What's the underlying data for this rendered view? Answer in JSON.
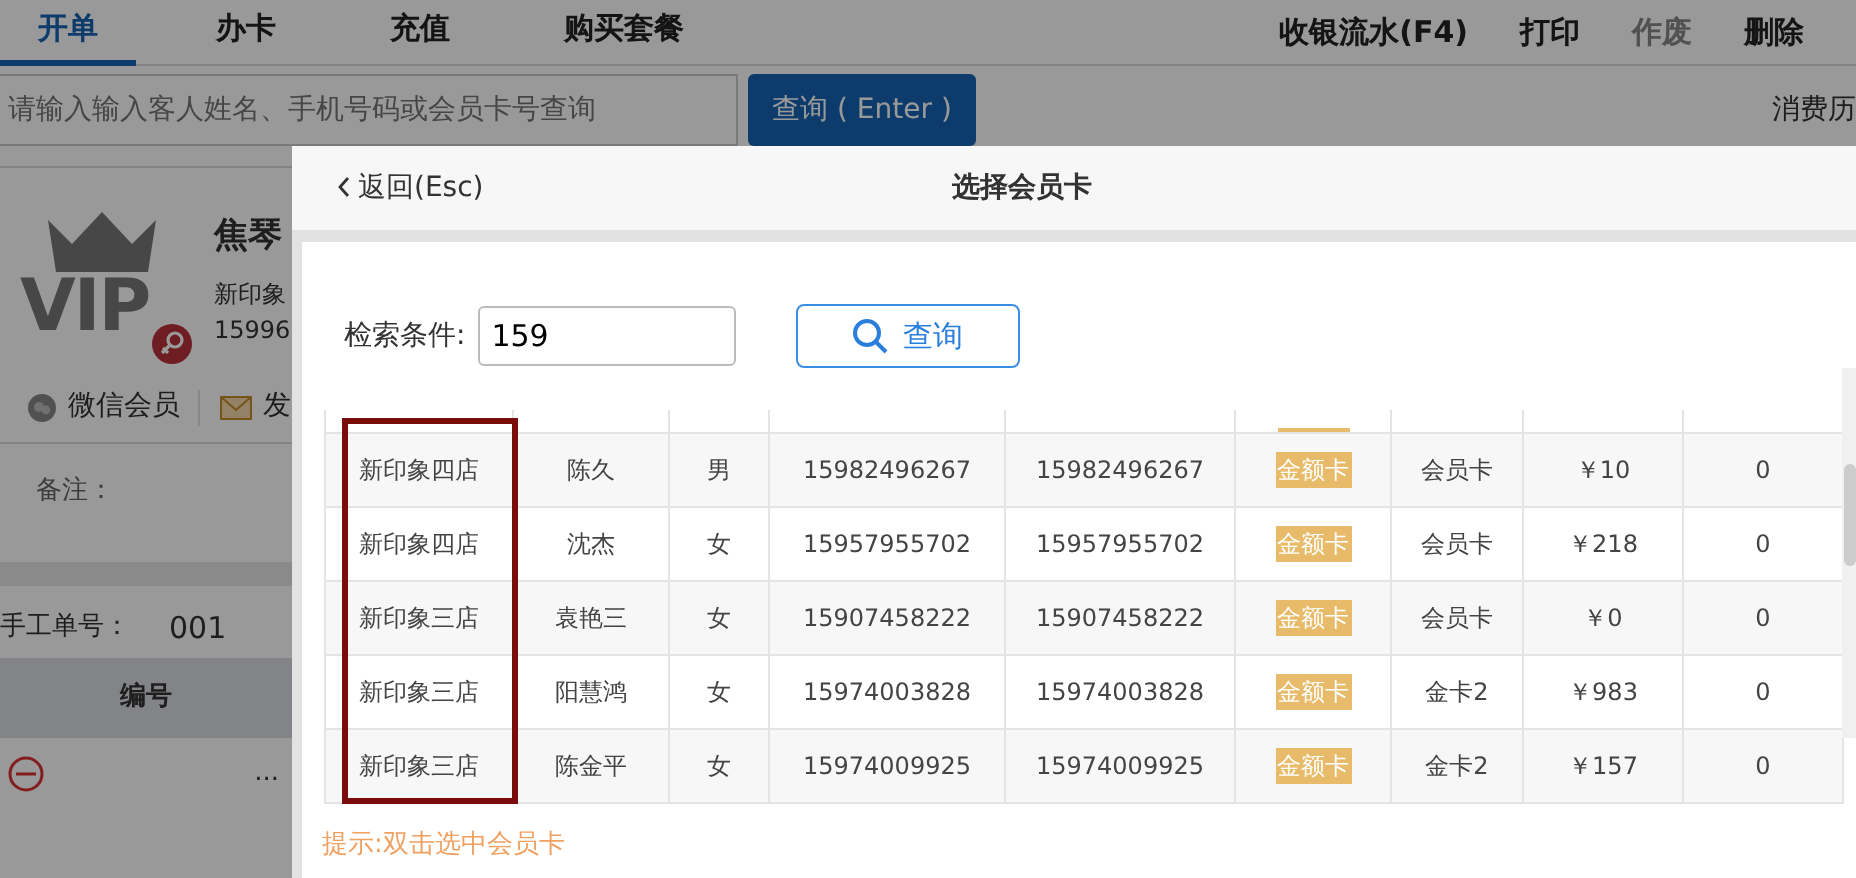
{
  "tabs": [
    {
      "label": "开单",
      "selected": true
    },
    {
      "label": "办卡",
      "selected": false
    },
    {
      "label": "充值",
      "selected": false
    },
    {
      "label": "购买套餐",
      "selected": false
    }
  ],
  "actions": [
    {
      "label": "收银流水(F4)",
      "disabled": false
    },
    {
      "label": "打印",
      "disabled": false
    },
    {
      "label": "作废",
      "disabled": true
    },
    {
      "label": "删除",
      "disabled": false
    }
  ],
  "search": {
    "placeholder": "请输入输入客人姓名、手机号码或会员卡号查询",
    "button": "查询 ( Enter )"
  },
  "history_link": "消费历",
  "member": {
    "logo": "VIP",
    "name": "焦琴",
    "store": "新印象",
    "phone": "15996",
    "wechat": "微信会员",
    "send": "发"
  },
  "remark_label": "备注：",
  "manual_no": {
    "label": "手工单号：",
    "value": "001"
  },
  "order_table": {
    "columns": [
      "编号"
    ],
    "rows": [
      {
        "cell": "..."
      }
    ]
  },
  "dialog": {
    "back": "返回(Esc)",
    "title": "选择会员卡",
    "search_label": "检索条件:",
    "search_value": "159",
    "search_button": "查询",
    "store_column_outlined": true,
    "rows": [
      {
        "store": "新印象四店",
        "name": "陈久",
        "gender": "男",
        "phone": "15982496267",
        "card_no": "15982496267",
        "card_type": "金额卡",
        "level": "会员卡",
        "balance": "￥10",
        "points": "0"
      },
      {
        "store": "新印象四店",
        "name": "沈杰",
        "gender": "女",
        "phone": "15957955702",
        "card_no": "15957955702",
        "card_type": "金额卡",
        "level": "会员卡",
        "balance": "￥218",
        "points": "0"
      },
      {
        "store": "新印象三店",
        "name": "袁艳三",
        "gender": "女",
        "phone": "15907458222",
        "card_no": "15907458222",
        "card_type": "金额卡",
        "level": "会员卡",
        "balance": "￥0",
        "points": "0"
      },
      {
        "store": "新印象三店",
        "name": "阳慧鸿",
        "gender": "女",
        "phone": "15974003828",
        "card_no": "15974003828",
        "card_type": "金额卡",
        "level": "金卡2",
        "balance": "￥983",
        "points": "0"
      },
      {
        "store": "新印象三店",
        "name": "陈金平",
        "gender": "女",
        "phone": "15974009925",
        "card_no": "15974009925",
        "card_type": "金额卡",
        "level": "金卡2",
        "balance": "￥157",
        "points": "0"
      }
    ],
    "hint": "提示:双击选中会员卡"
  }
}
